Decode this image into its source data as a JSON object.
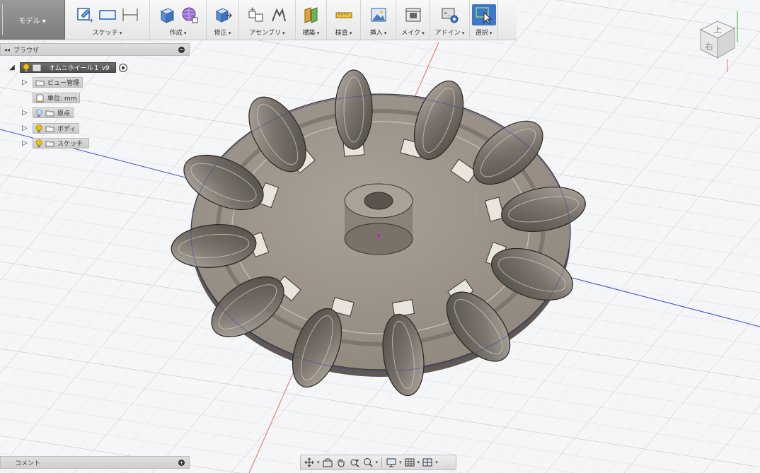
{
  "toolbar": {
    "mode_label": "モデル ▾",
    "groups": [
      {
        "id": "sketch",
        "label": "スケッチ"
      },
      {
        "id": "create",
        "label": "作成"
      },
      {
        "id": "modify",
        "label": "修正"
      },
      {
        "id": "assemble",
        "label": "アセンブリ"
      },
      {
        "id": "construct",
        "label": "構築"
      },
      {
        "id": "inspect",
        "label": "検査"
      },
      {
        "id": "insert",
        "label": "挿入"
      },
      {
        "id": "make",
        "label": "メイク"
      },
      {
        "id": "addins",
        "label": "アドイン"
      },
      {
        "id": "select",
        "label": "選択"
      }
    ]
  },
  "browser": {
    "title": "ブラウザ",
    "root": {
      "label": "オムニホイール１ v9"
    },
    "items": [
      {
        "label": "ビュー管理"
      },
      {
        "label": "単位: mm"
      },
      {
        "label": "原点"
      },
      {
        "label": "ボディ"
      },
      {
        "label": "スケッチ"
      }
    ]
  },
  "comments": {
    "title": "コメント"
  },
  "view_cube": {
    "top_face": "上",
    "front_face": "右"
  },
  "colors": {
    "accent": "#3c78c8",
    "model_body": "#a39a90",
    "roller": "#8f8980",
    "bulb": "#f2c200"
  }
}
